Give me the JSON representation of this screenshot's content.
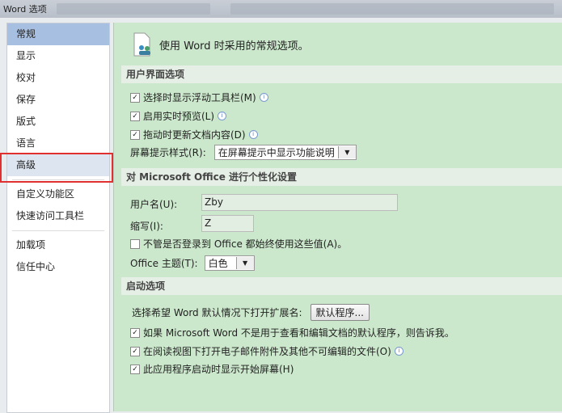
{
  "window": {
    "title": "Word 选项"
  },
  "sidebar": {
    "items": [
      {
        "label": "常规"
      },
      {
        "label": "显示"
      },
      {
        "label": "校对"
      },
      {
        "label": "保存"
      },
      {
        "label": "版式"
      },
      {
        "label": "语言"
      },
      {
        "label": "高级"
      },
      {
        "label": "自定义功能区"
      },
      {
        "label": "快速访问工具栏"
      },
      {
        "label": "加载项"
      },
      {
        "label": "信任中心"
      }
    ]
  },
  "main": {
    "intro": "使用 Word 时采用的常规选项。",
    "ui_section": {
      "title": "用户界面选项",
      "opt1": "选择时显示浮动工具栏(M)",
      "opt2": "启用实时预览(L)",
      "opt3": "拖动时更新文档内容(D)",
      "tooltip_label": "屏幕提示样式(R):",
      "tooltip_value": "在屏幕提示中显示功能说明"
    },
    "personal_section": {
      "title": "对 Microsoft Office 进行个性化设置",
      "username_label": "用户名(U):",
      "username_value": "Zby",
      "initials_label": "缩写(I):",
      "initials_value": "Z",
      "always_use": "不管是否登录到 Office 都始终使用这些值(A)。",
      "theme_label": "Office 主题(T):",
      "theme_value": "白色"
    },
    "startup_section": {
      "title": "启动选项",
      "ext_label": "选择希望 Word 默认情况下打开扩展名:",
      "default_programs_button": "默认程序...",
      "opt1": "如果 Microsoft Word 不是用于查看和编辑文档的默认程序，则告诉我。",
      "opt2": "在阅读视图下打开电子邮件附件及其他不可编辑的文件(O)",
      "opt3": "此应用程序启动时显示开始屏幕(H)"
    }
  }
}
